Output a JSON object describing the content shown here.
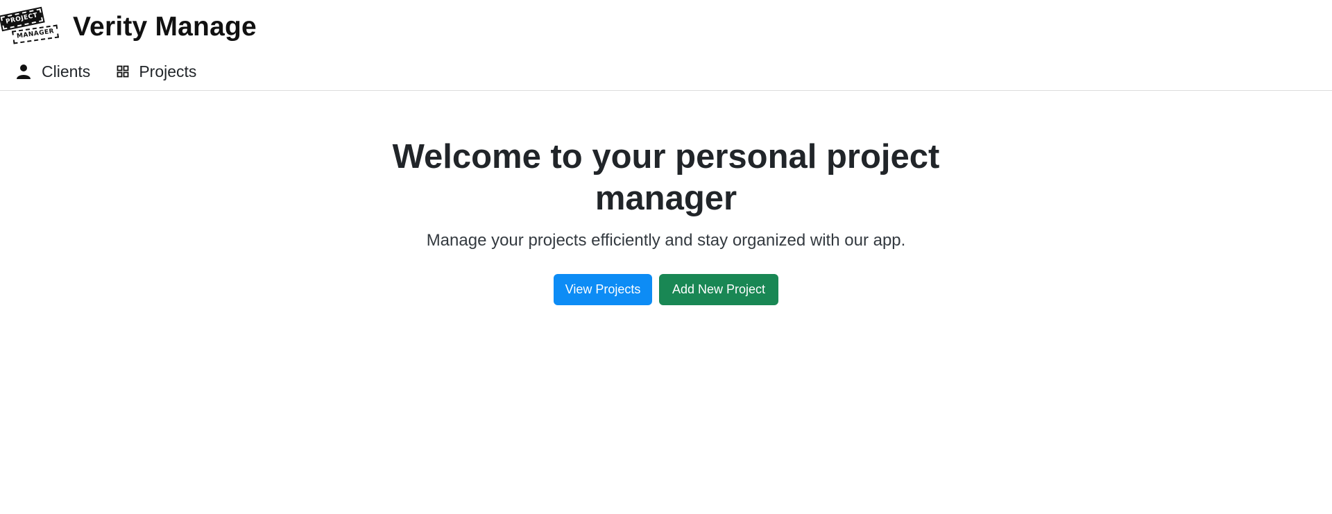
{
  "app": {
    "title": "Verity Manage",
    "logo_text_top": "PROJECT",
    "logo_text_bottom": "MANAGER"
  },
  "nav": {
    "items": [
      {
        "label": "Clients",
        "icon": "person-icon"
      },
      {
        "label": "Projects",
        "icon": "grid-icon"
      }
    ]
  },
  "hero": {
    "heading": "Welcome to your personal project manager",
    "lead": "Manage your projects efficiently and stay organized with our app.",
    "primary_button": "View Projects",
    "secondary_button": "Add New Project"
  },
  "colors": {
    "primary": "#0d8cf5",
    "success": "#198754",
    "text": "#212529"
  }
}
